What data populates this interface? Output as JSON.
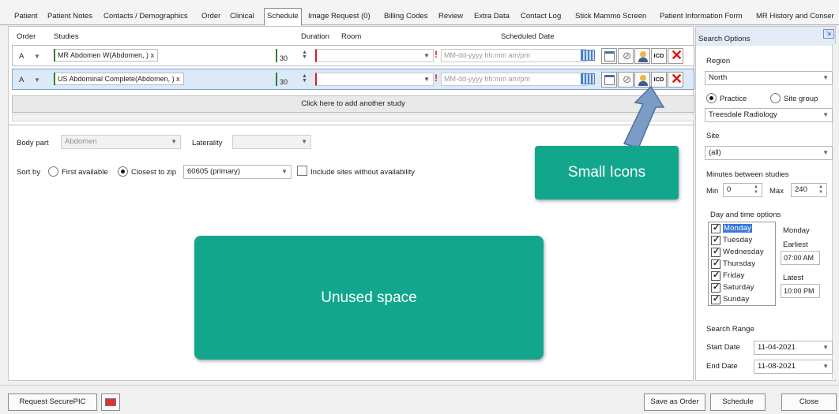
{
  "tabs": [
    {
      "label": "Patient"
    },
    {
      "label": "Patient Notes"
    },
    {
      "label": "Contacts / Demographics"
    },
    {
      "label": "Order"
    },
    {
      "label": "Clinical"
    },
    {
      "label": "Schedule"
    },
    {
      "label": "Image Request (0)"
    },
    {
      "label": "Billing Codes"
    },
    {
      "label": "Review"
    },
    {
      "label": "Extra Data"
    },
    {
      "label": "Contact Log"
    },
    {
      "label": "Stick Mammo Screen"
    },
    {
      "label": "Patient Information Form"
    },
    {
      "label": "MR History and Conser"
    }
  ],
  "active_tab": "Schedule",
  "headers": {
    "order": "Order",
    "studies": "Studies",
    "duration": "Duration",
    "room": "Room",
    "scheduled_date": "Scheduled Date"
  },
  "studies": [
    {
      "order": "A",
      "study": "MR Abdomen W(Abdomen, )   x",
      "duration": "30",
      "room": "",
      "date_placeholder": "MM-dd-yyyy hh:mm am/pm",
      "selected": false
    },
    {
      "order": "A",
      "study": "US Abdominal Complete(Abdomen, )   x",
      "duration": "30",
      "room": "",
      "date_placeholder": "MM-dd-yyyy hh:mm am/pm",
      "selected": true
    }
  ],
  "icd_label": "ICD",
  "add_study": "Click here to add another study",
  "body_part": {
    "label": "Body part",
    "value": "Abdomen"
  },
  "laterality": {
    "label": "Laterality",
    "value": ""
  },
  "sort": {
    "label": "Sort by",
    "first_available": "First available",
    "closest_to_zip": "Closest to zip",
    "selected": "closest_to_zip",
    "zip_value": "60605 (primary)",
    "include_label": "Include sites without availability",
    "include_checked": false
  },
  "callouts": {
    "small_icons": "Small Icons",
    "unused_space": "Unused space"
  },
  "search": {
    "title": "Search Options",
    "region_label": "Region",
    "region_value": "North",
    "practice_label": "Practice",
    "site_group_label": "Site group",
    "practice_selected": true,
    "practice_value": "Treesdale Radiology",
    "site_label": "Site",
    "site_value": "(all)",
    "minutes_label": "Minutes between studies",
    "min_label": "Min",
    "min_value": "0",
    "max_label": "Max",
    "max_value": "240",
    "day_time_label": "Day and time options",
    "days": [
      {
        "name": "Monday",
        "checked": true
      },
      {
        "name": "Tuesday",
        "checked": true
      },
      {
        "name": "Wednesday",
        "checked": true
      },
      {
        "name": "Thursday",
        "checked": true
      },
      {
        "name": "Friday",
        "checked": true
      },
      {
        "name": "Saturday",
        "checked": true
      },
      {
        "name": "Sunday",
        "checked": true
      }
    ],
    "selected_day": "Monday",
    "earliest_label": "Earliest",
    "earliest_value": "07:00 AM",
    "latest_label": "Latest",
    "latest_value": "10:00 PM",
    "range_label": "Search Range",
    "start_label": "Start Date",
    "start_value": "11-04-2021",
    "end_label": "End Date",
    "end_value": "11-08-2021"
  },
  "bottom": {
    "request_securepic": "Request SecurePIC",
    "save_as_order": "Save as Order",
    "schedule": "Schedule",
    "close": "Close"
  },
  "colors": {
    "accent": "#12a78c",
    "selected_row": "#dce9f7",
    "required_marker": "#d62020",
    "valid_marker": "#2f7d32",
    "day_highlight": "#3b78d8"
  }
}
